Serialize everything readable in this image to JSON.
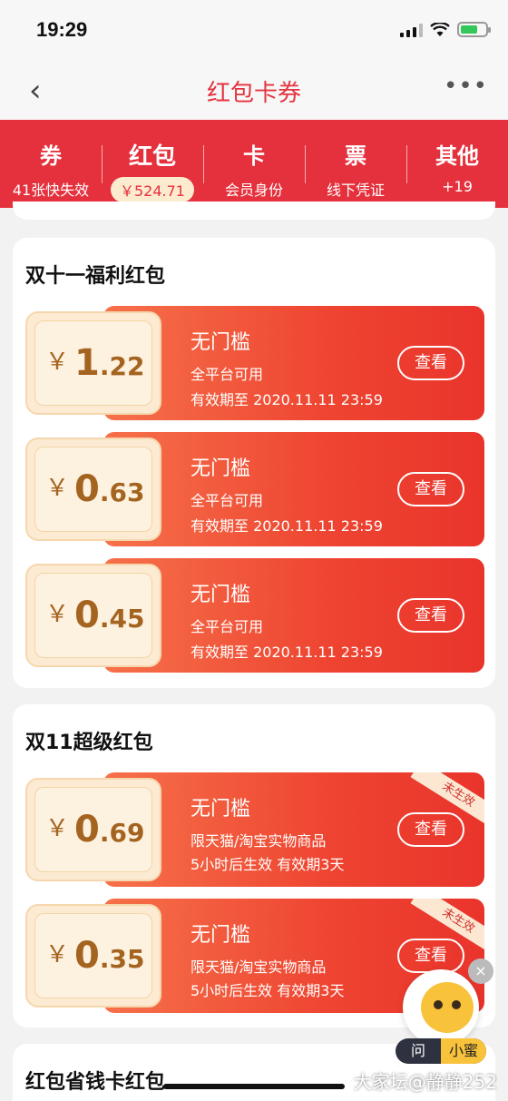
{
  "status": {
    "time": "19:29"
  },
  "nav": {
    "back": "‹",
    "title": "红包卡券",
    "more": "•••"
  },
  "tabs": [
    {
      "name": "券",
      "sub": "41张快失效"
    },
    {
      "name": "红包",
      "sub": "￥524.71"
    },
    {
      "name": "卡",
      "sub": "会员身份"
    },
    {
      "name": "票",
      "sub": "线下凭证"
    },
    {
      "name": "其他",
      "sub": "+19"
    }
  ],
  "sections": [
    {
      "title": "双十一福利红包",
      "coupons": [
        {
          "yen": "￥",
          "int": "1",
          "dec": ".22",
          "title": "无门槛",
          "line1": "全平台可用",
          "line2": "有效期至 2020.11.11 23:59",
          "button": "查看"
        },
        {
          "yen": "￥",
          "int": "0",
          "dec": ".63",
          "title": "无门槛",
          "line1": "全平台可用",
          "line2": "有效期至 2020.11.11 23:59",
          "button": "查看"
        },
        {
          "yen": "￥",
          "int": "0",
          "dec": ".45",
          "title": "无门槛",
          "line1": "全平台可用",
          "line2": "有效期至 2020.11.11 23:59",
          "button": "查看"
        }
      ]
    },
    {
      "title": "双11超级红包",
      "coupons": [
        {
          "yen": "￥",
          "int": "0",
          "dec": ".69",
          "title": "无门槛",
          "line1": "限天猫/淘宝实物商品",
          "line2": "5小时后生效 有效期3天",
          "button": "查看",
          "badge": "未生效"
        },
        {
          "yen": "￥",
          "int": "0",
          "dec": ".35",
          "title": "无门槛",
          "line1": "限天猫/淘宝实物商品",
          "line2": "5小时后生效 有效期3天",
          "button": "查看",
          "badge": "未生效"
        }
      ]
    },
    {
      "title": "红包省钱卡红包"
    }
  ],
  "helper": {
    "ask": "问",
    "name": "小蜜",
    "close": "×"
  },
  "watermark": "大家坛@静静252"
}
